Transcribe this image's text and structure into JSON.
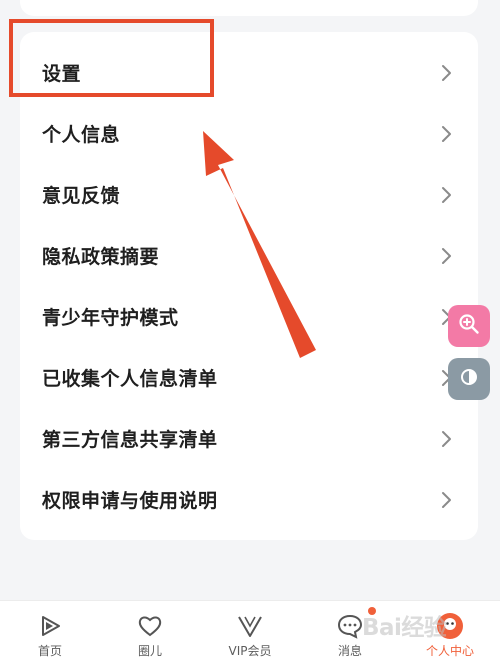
{
  "menu": {
    "items": [
      {
        "label": "设置"
      },
      {
        "label": "个人信息"
      },
      {
        "label": "意见反馈"
      },
      {
        "label": "隐私政策摘要"
      },
      {
        "label": "青少年守护模式"
      },
      {
        "label": "已收集个人信息清单"
      },
      {
        "label": "第三方信息共享清单"
      },
      {
        "label": "权限申请与使用说明"
      }
    ]
  },
  "tabbar": {
    "tabs": [
      {
        "label": "首页",
        "icon": "home-play-icon"
      },
      {
        "label": "圈儿",
        "icon": "circle-heart-icon"
      },
      {
        "label": "VIP会员",
        "icon": "vip-v-icon"
      },
      {
        "label": "消息",
        "icon": "message-bubble-icon"
      },
      {
        "label": "个人中心",
        "icon": "avatar-icon"
      }
    ],
    "active_tab": "个人中心"
  },
  "floating": {
    "search_icon": "zoom-in-icon",
    "contrast_icon": "contrast-icon"
  },
  "annotation": {
    "highlight_color": "#e54a2b"
  },
  "watermark": {
    "text": "Bai经验"
  },
  "colors": {
    "accent": "#f0603a",
    "pink_button": "#f37aa6",
    "gray_button": "#8b9aa4"
  }
}
